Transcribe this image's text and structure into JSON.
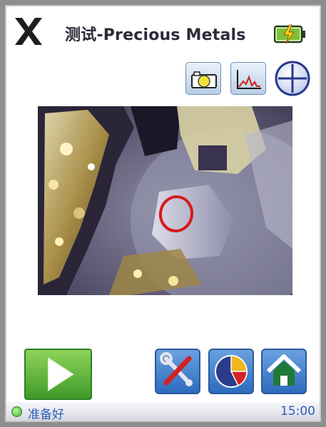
{
  "header": {
    "title": "测试-Precious Metals",
    "close_icon": "close-x-icon",
    "battery_icon": "battery-charging-icon"
  },
  "toolbar": {
    "camera_icon": "camera-icon",
    "spectrum_icon": "spectrum-icon",
    "crosshair_icon": "crosshair-plus-icon"
  },
  "viewer": {
    "target_marker_color": "#d61b1b"
  },
  "actions": {
    "start_icon": "play-icon",
    "tools_icon": "tools-icon",
    "results_icon": "pie-chart-icon",
    "home_icon": "home-icon"
  },
  "status": {
    "state": "准备好",
    "time": "15:00",
    "indicator_color": "#3fae2a"
  },
  "colors": {
    "accent": "#2e6bbd",
    "play": "#4caf2f",
    "text": "#2a5fb5"
  }
}
